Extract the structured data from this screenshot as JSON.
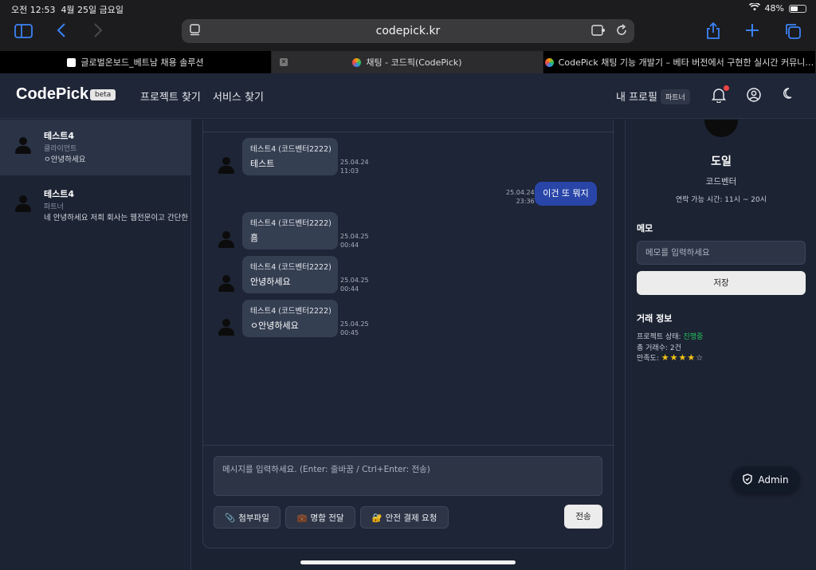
{
  "status": {
    "time": "오전 12:53",
    "date": "4월 25일 금요일",
    "battery": "48%",
    "battery_level": 0.48
  },
  "browser": {
    "url": "codepick.kr",
    "tabs": [
      {
        "title": "글로벌온보드_베트남 채용 솔루션"
      },
      {
        "title": "채팅 - 코드픽(CodePick)"
      },
      {
        "title": "CodePick 채팅 기능 개발기 – 베타 버전에서 구현한 실시간 커뮤니…"
      }
    ]
  },
  "header": {
    "logo": "CodePick",
    "beta": "beta",
    "nav": [
      "프로젝트 찾기",
      "서비스 찾기"
    ],
    "profile": "내 프로필",
    "profile_badge": "파트너"
  },
  "conversations": [
    {
      "name": "테스트4",
      "role": "클라이언트",
      "last": "ㅇ안녕하세요"
    },
    {
      "name": "테스트4",
      "role": "파트너",
      "last": "네 안녕하세요 저희 회사는 웹전문이고 간단한"
    }
  ],
  "messages": [
    {
      "sender": "테스트4 (코드벤터2222)",
      "text": "테스트",
      "date": "25.04.24",
      "time": "11:03"
    },
    {
      "mine": true,
      "text": "이건 또 뭐지",
      "date": "25.04.24",
      "time": "23:36"
    },
    {
      "sender": "테스트4 (코드벤터2222)",
      "text": "흠",
      "date": "25.04.25",
      "time": "00:44"
    },
    {
      "sender": "테스트4 (코드벤터2222)",
      "text": "안녕하세요",
      "date": "25.04.25",
      "time": "00:44"
    },
    {
      "sender": "테스트4 (코드벤터2222)",
      "text": "ㅇ안녕하세요",
      "date": "25.04.25",
      "time": "00:45"
    }
  ],
  "composer": {
    "placeholder": "메시지를 입력하세요. (Enter: 줄바꿈 / Ctrl+Enter: 전송)",
    "attach": "첨부파일",
    "card": "명함 전달",
    "payment": "안전 결제 요청",
    "send": "전송"
  },
  "profile_panel": {
    "name": "도일",
    "role": "코드벤터",
    "hours": "연락 가능 시간: 11시 ~ 20시",
    "memo_title": "메모",
    "memo_placeholder": "메모를 입력하세요",
    "save": "저장",
    "deal_title": "거래 정보",
    "status_label": "프로젝트 상태: ",
    "status_value": "진행중",
    "total_deals": "총 거래수: 2건",
    "satisfaction_label": "만족도: ",
    "stars_filled": "★★★★",
    "stars_empty": "☆",
    "colors": {
      "status": "#22c55e",
      "stars": "#f5c518",
      "accent": "#2945a8"
    }
  },
  "admin": "Admin"
}
